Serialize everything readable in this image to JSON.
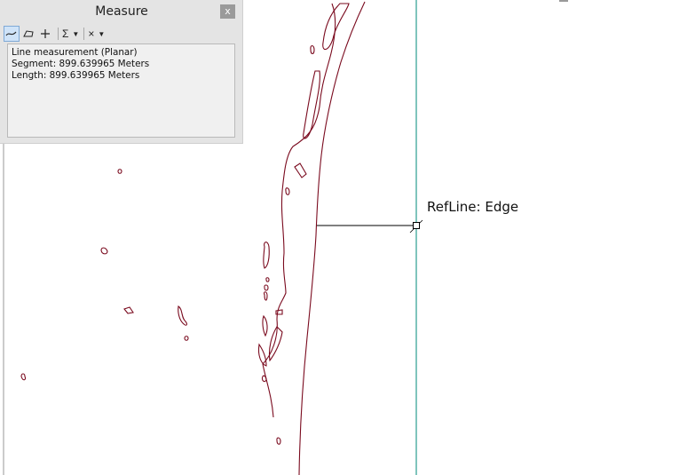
{
  "measure_window": {
    "title": "Measure",
    "close_label": "x",
    "toolbar": {
      "line_tool_icon": "measure-line-icon",
      "area_tool_icon": "measure-area-icon",
      "feature_tool_icon": "measure-feature-icon",
      "sum_label": "Σ",
      "clear_label": "×"
    },
    "results": {
      "line1": "Line measurement (Planar)",
      "line2": "Segment: 899.639965 Meters",
      "line3": "Length: 899.639965 Meters"
    }
  },
  "map": {
    "snap_label": "RefLine: Edge",
    "colors": {
      "shoreline": "#7a0a1e",
      "refline": "#2a9d8f",
      "measure_line": "#000000"
    }
  }
}
